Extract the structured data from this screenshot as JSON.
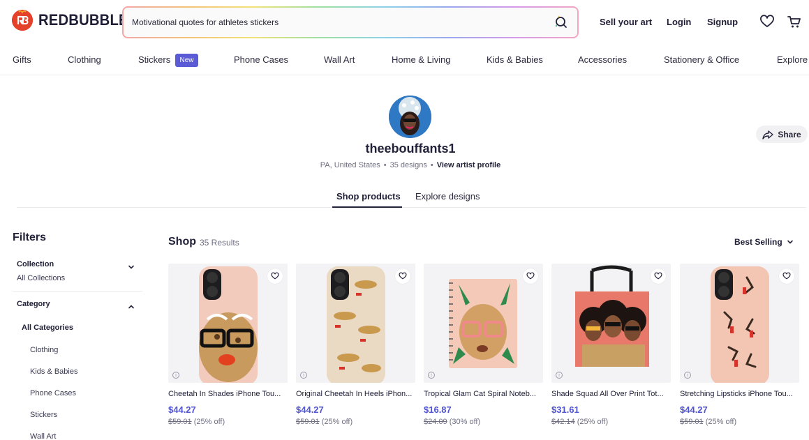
{
  "header": {
    "logo_text": "REDBUBBLE",
    "search_value": "Motivational quotes for athletes stickers",
    "sell_label": "Sell your art",
    "login_label": "Login",
    "signup_label": "Signup"
  },
  "nav": {
    "items": [
      "Gifts",
      "Clothing",
      "Stickers",
      "Phone Cases",
      "Wall Art",
      "Home & Living",
      "Kids & Babies",
      "Accessories",
      "Stationery & Office",
      "Explore"
    ],
    "new_badge": "New"
  },
  "profile": {
    "name": "theebouffants1",
    "location": "PA, United States",
    "designs": "35 designs",
    "view_profile": "View artist profile",
    "share_label": "Share"
  },
  "tabs": {
    "active": "Shop products",
    "other": "Explore designs"
  },
  "filters": {
    "title": "Filters",
    "collection_label": "Collection",
    "collection_value": "All Collections",
    "category_label": "Category",
    "categories": [
      "All Categories",
      "Clothing",
      "Kids & Babies",
      "Phone Cases",
      "Stickers",
      "Wall Art"
    ]
  },
  "shop": {
    "title": "Shop",
    "count": "35 Results",
    "sort_label": "Best Selling"
  },
  "products": [
    {
      "title": "Cheetah In Shades iPhone Tou...",
      "price": "$44.27",
      "old_price": "$59.01",
      "discount": "(25% off)"
    },
    {
      "title": "Original Cheetah In Heels iPhon...",
      "price": "$44.27",
      "old_price": "$59.01",
      "discount": "(25% off)"
    },
    {
      "title": "Tropical Glam Cat Spiral Noteb...",
      "price": "$16.87",
      "old_price": "$24.09",
      "discount": "(30% off)"
    },
    {
      "title": "Shade Squad All Over Print Tot...",
      "price": "$31.61",
      "old_price": "$42.14",
      "discount": "(25% off)"
    },
    {
      "title": "Stretching Lipsticks iPhone Tou...",
      "price": "$44.27",
      "old_price": "$59.01",
      "discount": "(25% off)"
    }
  ],
  "colors": {
    "brand_red": "#e4412b",
    "price_purple": "#5154cf",
    "badge_purple": "#5b5bd6"
  }
}
